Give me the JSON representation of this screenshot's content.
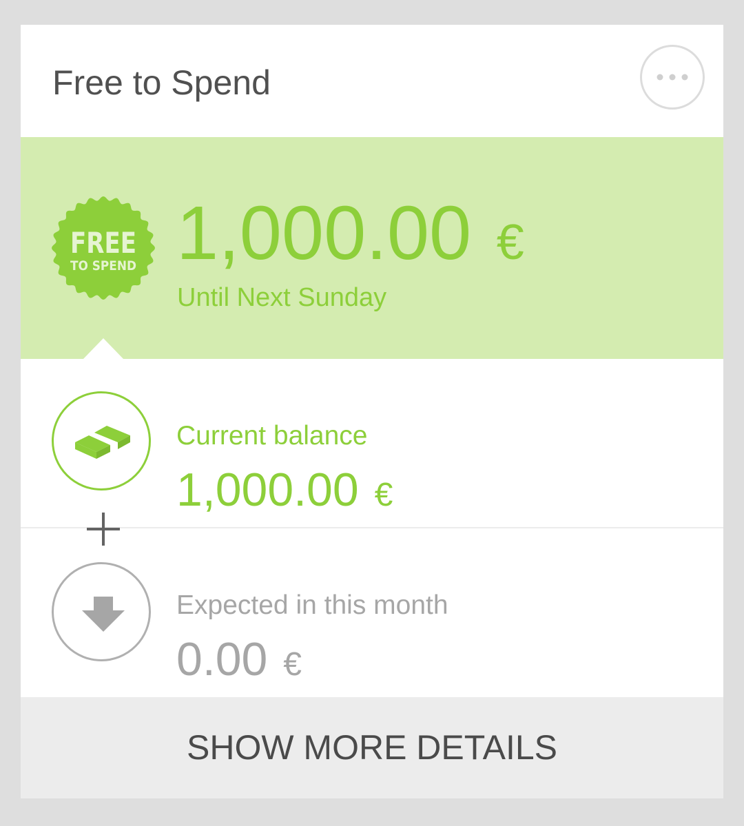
{
  "card": {
    "title": "Free to Spend",
    "more_button_label": "More options"
  },
  "hero": {
    "badge_line1": "FREE",
    "badge_line2": "TO SPEND",
    "amount": "1,000.00",
    "currency": "€",
    "subtitle": "Until Next Sunday",
    "accent_color": "#8dcf3a",
    "background_color": "#d4ecb0"
  },
  "balance": {
    "label": "Current balance",
    "amount": "1,000.00",
    "currency": "€",
    "icon": "money-bills-icon"
  },
  "operator": "+",
  "expected": {
    "label": "Expected in this month",
    "amount": "0.00",
    "currency": "€",
    "icon": "download-arrow-icon"
  },
  "footer": {
    "details_label": "SHOW MORE DETAILS"
  }
}
